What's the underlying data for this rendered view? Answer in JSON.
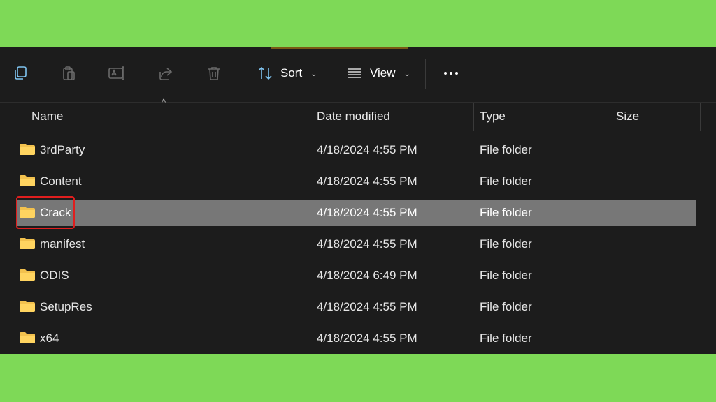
{
  "toolbar": {
    "sort_label": "Sort",
    "view_label": "View"
  },
  "columns": {
    "name": "Name",
    "date_modified": "Date modified",
    "type": "Type",
    "size": "Size"
  },
  "files": [
    {
      "name": "3rdParty",
      "date": "4/18/2024 4:55 PM",
      "type": "File folder",
      "size": ""
    },
    {
      "name": "Content",
      "date": "4/18/2024 4:55 PM",
      "type": "File folder",
      "size": ""
    },
    {
      "name": "Crack",
      "date": "4/18/2024 4:55 PM",
      "type": "File folder",
      "size": "",
      "selected": true
    },
    {
      "name": "manifest",
      "date": "4/18/2024 4:55 PM",
      "type": "File folder",
      "size": ""
    },
    {
      "name": "ODIS",
      "date": "4/18/2024 6:49 PM",
      "type": "File folder",
      "size": ""
    },
    {
      "name": "SetupRes",
      "date": "4/18/2024 4:55 PM",
      "type": "File folder",
      "size": ""
    },
    {
      "name": "x64",
      "date": "4/18/2024 4:55 PM",
      "type": "File folder",
      "size": ""
    }
  ],
  "colors": {
    "background": "#7ed957",
    "window": "#1c1c1c",
    "selected_row": "#777777",
    "folder": "#f2c14e",
    "highlight": "#e01e1e"
  }
}
